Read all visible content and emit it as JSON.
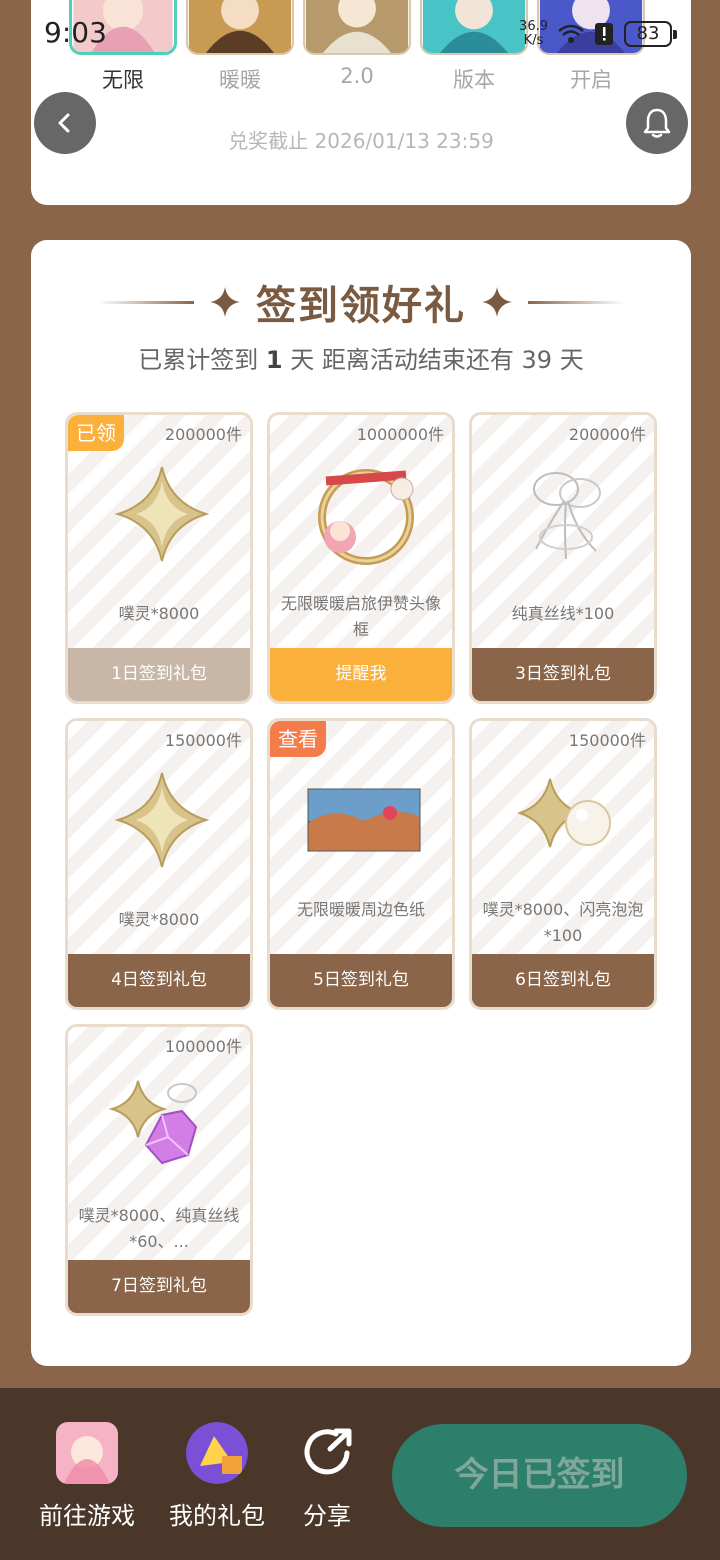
{
  "status_bar": {
    "time": "9:03",
    "net_speed_value": "36.9",
    "net_speed_unit": "K/s",
    "battery": "83"
  },
  "top_tabs": [
    {
      "label": "无限",
      "active": true
    },
    {
      "label": "暖暖",
      "active": false
    },
    {
      "label": "2.0",
      "active": false
    },
    {
      "label": "版本",
      "active": false
    },
    {
      "label": "开启",
      "active": false
    }
  ],
  "deadline": "兑奖截止 2026/01/13 23:59",
  "checkin": {
    "title": "签到领好礼",
    "subtitle_prefix": "已累计签到",
    "days_count": "1",
    "subtitle_mid": "天  距离活动结束还有 39 天"
  },
  "gifts": [
    {
      "qty": "200000件",
      "name": "噗灵*8000",
      "button": "1日签到礼包",
      "badge": "已领",
      "state": "claimed"
    },
    {
      "qty": "1000000件",
      "name": "无限暖暖启旅伊赞头像框",
      "button": "提醒我",
      "badge": "",
      "state": "remind"
    },
    {
      "qty": "200000件",
      "name": "纯真丝线*100",
      "button": "3日签到礼包",
      "badge": "",
      "state": "normal"
    },
    {
      "qty": "150000件",
      "name": "噗灵*8000",
      "button": "4日签到礼包",
      "badge": "",
      "state": "normal"
    },
    {
      "qty": "",
      "name": "无限暖暖周边色纸",
      "button": "5日签到礼包",
      "badge": "查看",
      "state": "normal"
    },
    {
      "qty": "150000件",
      "name": "噗灵*8000、闪亮泡泡*100",
      "button": "6日签到礼包",
      "badge": "",
      "state": "normal"
    },
    {
      "qty": "100000件",
      "name": "噗灵*8000、纯真丝线*60、...",
      "button": "7日签到礼包",
      "badge": "",
      "state": "normal"
    }
  ],
  "bottom_bar": {
    "go_game": "前往游戏",
    "my_gifts": "我的礼包",
    "share": "分享",
    "checkin_button": "今日已签到"
  },
  "icons": {
    "back": "chevron-left-icon",
    "bell": "bell-icon",
    "share": "share-icon"
  },
  "colors": {
    "brown": "#8a6549",
    "orange": "#fbb03b",
    "teal_button": "#2d7e6a",
    "claimed_gray": "#c8b7a7",
    "tab_highlight": "#4fd0b8",
    "view_badge": "#f47b4a"
  }
}
